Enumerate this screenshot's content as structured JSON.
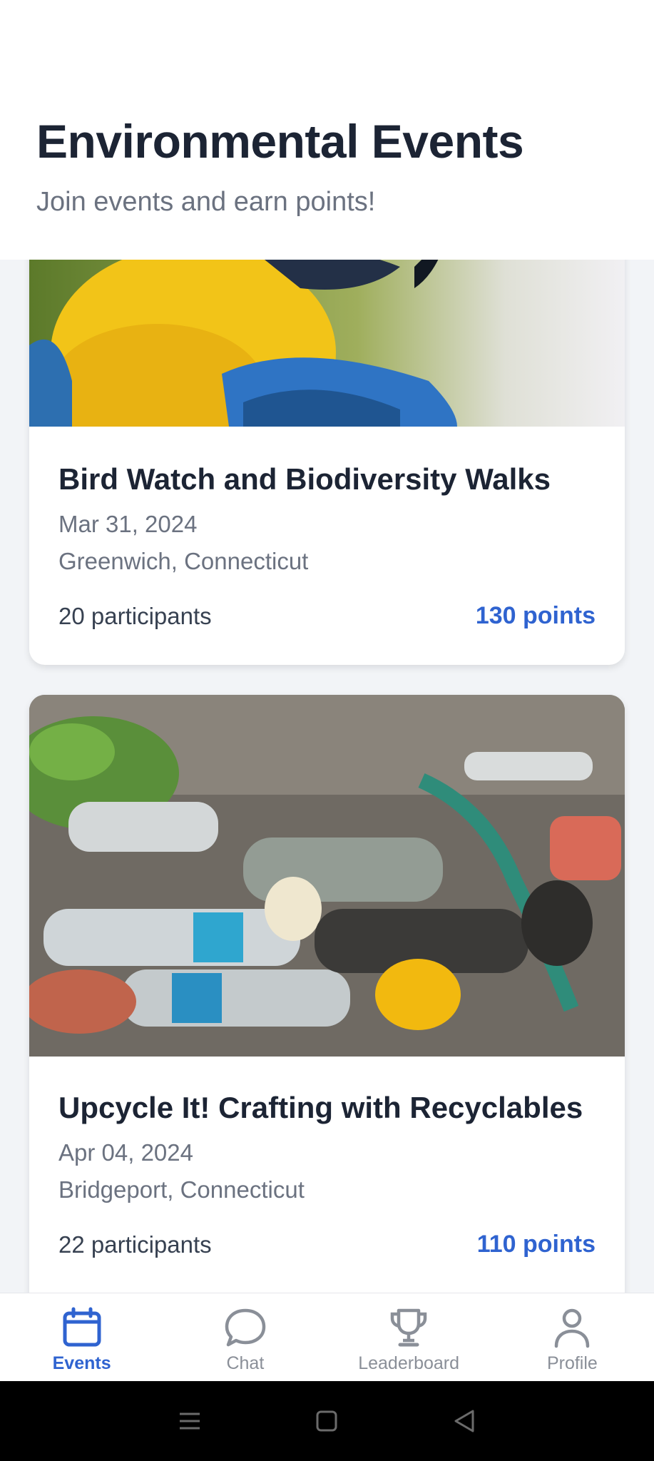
{
  "header": {
    "title": "Environmental Events",
    "subtitle": "Join events and earn points!"
  },
  "events": [
    {
      "title": "Bird Watch and Biodiversity Walks",
      "date": "Mar 31, 2024",
      "location": "Greenwich, Connecticut",
      "participants": "20 participants",
      "points": "130 points"
    },
    {
      "title": "Upcycle It! Crafting with Recyclables",
      "date": "Apr 04, 2024",
      "location": "Bridgeport, Connecticut",
      "participants": "22 participants",
      "points": "110 points"
    }
  ],
  "tabs": [
    {
      "label": "Events",
      "icon": "calendar-icon",
      "active": true
    },
    {
      "label": "Chat",
      "icon": "chat-bubble-icon",
      "active": false
    },
    {
      "label": "Leaderboard",
      "icon": "trophy-icon",
      "active": false
    },
    {
      "label": "Profile",
      "icon": "person-icon",
      "active": false
    }
  ],
  "colors": {
    "accent": "#2f63d0",
    "text": "#1c2434",
    "muted": "#6b7280",
    "background": "#f2f4f7"
  }
}
